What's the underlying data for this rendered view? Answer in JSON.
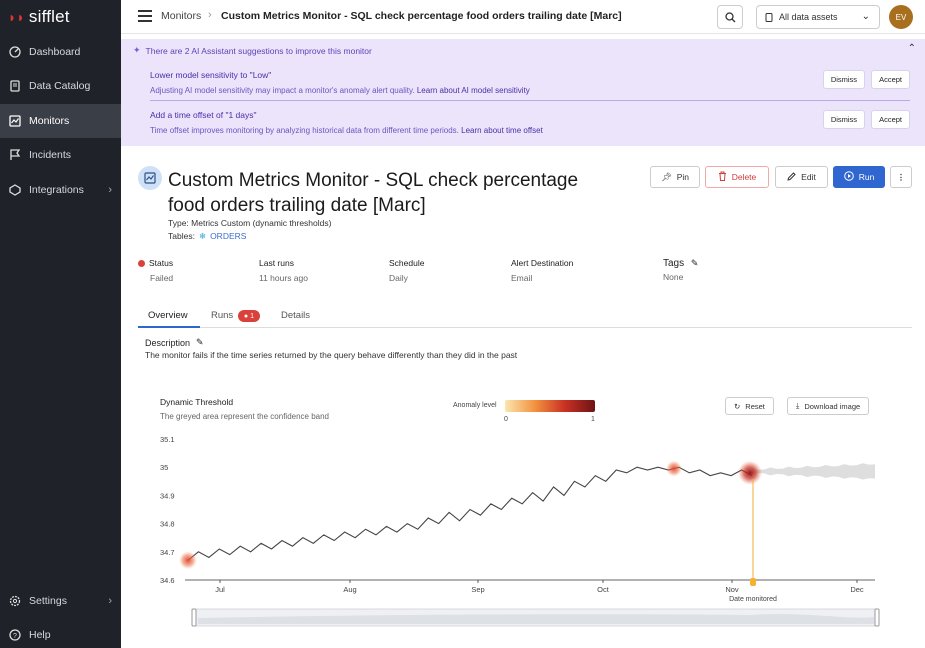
{
  "app": {
    "logo": "sifflet"
  },
  "sidebar": {
    "items": [
      {
        "label": "Dashboard",
        "icon": "dashboard-icon"
      },
      {
        "label": "Data Catalog",
        "icon": "catalog-icon"
      },
      {
        "label": "Monitors",
        "icon": "monitor-icon"
      },
      {
        "label": "Incidents",
        "icon": "flag-icon"
      },
      {
        "label": "Integrations",
        "icon": "integrations-icon"
      }
    ],
    "bottom": [
      {
        "label": "Settings",
        "icon": "gear-icon"
      },
      {
        "label": "Help",
        "icon": "help-icon"
      }
    ]
  },
  "topbar": {
    "breadcrumb_root": "Monitors",
    "breadcrumb_sep": "›",
    "breadcrumb_current": "Custom Metrics Monitor - SQL check percentage food orders trailing date [Marc]",
    "asset_select": "All data assets",
    "avatar_initials": "EV"
  },
  "ai_banner": {
    "header": "There are 2 AI Assistant suggestions to improve this monitor",
    "suggestions": [
      {
        "title": "Lower model sensitivity to \"Low\"",
        "desc": "Adjusting AI model sensitivity may impact a monitor's anomaly alert quality.",
        "link": "Learn about AI model sensitivity",
        "dismiss": "Dismiss",
        "accept": "Accept"
      },
      {
        "title": "Add a time offset of \"1 days\"",
        "desc": "Time offset improves monitoring by analyzing historical data from different time periods.",
        "link": "Learn about time offset",
        "dismiss": "Dismiss",
        "accept": "Accept"
      }
    ]
  },
  "monitor": {
    "title": "Custom Metrics Monitor - SQL check percentage food orders trailing date [Marc]",
    "type_label": "Type:",
    "type_value": "Metrics Custom (dynamic thresholds)",
    "tables_label": "Tables:",
    "tables_value": "ORDERS",
    "actions": {
      "pin": "Pin",
      "delete": "Delete",
      "edit": "Edit",
      "run": "Run"
    }
  },
  "meta": {
    "status_label": "Status",
    "status_value": "Failed",
    "last_runs_label": "Last runs",
    "last_runs_value": "11 hours ago",
    "schedule_label": "Schedule",
    "schedule_value": "Daily",
    "alert_label": "Alert Destination",
    "alert_value": "Email",
    "tags_label": "Tags",
    "tags_value": "None"
  },
  "tabs": {
    "overview": "Overview",
    "runs": "Runs",
    "runs_badge": "1",
    "details": "Details"
  },
  "description": {
    "label": "Description",
    "text": "The monitor fails if the time series returned by the query behave differently than they did in the past"
  },
  "chart": {
    "title": "Dynamic Threshold",
    "subtitle": "The greyed area represent the confidence band",
    "anomaly_label": "Anomaly level",
    "anomaly_min": "0",
    "anomaly_max": "1",
    "reset": "Reset",
    "download": "Download image",
    "x_axis_title": "Date monitored",
    "colors": {
      "line": "#444444",
      "anomaly": "#e0442f",
      "marker": "#f2b233",
      "band": "#d8d8d8"
    }
  },
  "chart_data": {
    "type": "line",
    "ylim": [
      34.6,
      35.1
    ],
    "yticks": [
      "35.1",
      "35",
      "34.9",
      "34.8",
      "34.7",
      "34.6"
    ],
    "xticks": [
      "Jul",
      "Aug",
      "Sep",
      "Oct",
      "Nov",
      "Dec"
    ],
    "series": [
      {
        "values": [
          34.67,
          34.7,
          34.68,
          34.71,
          34.69,
          34.72,
          34.7,
          34.73,
          34.71,
          34.74,
          34.72,
          34.75,
          34.73,
          34.76,
          34.74,
          34.77,
          34.75,
          34.78,
          34.76,
          34.79,
          34.77,
          34.8,
          34.78,
          34.82,
          34.8,
          34.84,
          34.81,
          34.85,
          34.83,
          34.87,
          34.85,
          34.89,
          34.87,
          34.91,
          34.88,
          34.93,
          34.9,
          34.95,
          34.93,
          34.97,
          34.95,
          34.99,
          34.98,
          35.0,
          34.99,
          35.0,
          34.99,
          35.0,
          34.98,
          34.99,
          34.97,
          34.98,
          34.97,
          34.99,
          34.97
        ]
      }
    ],
    "anomalies": [
      "first point",
      "mid-Oct",
      "Nov"
    ]
  }
}
